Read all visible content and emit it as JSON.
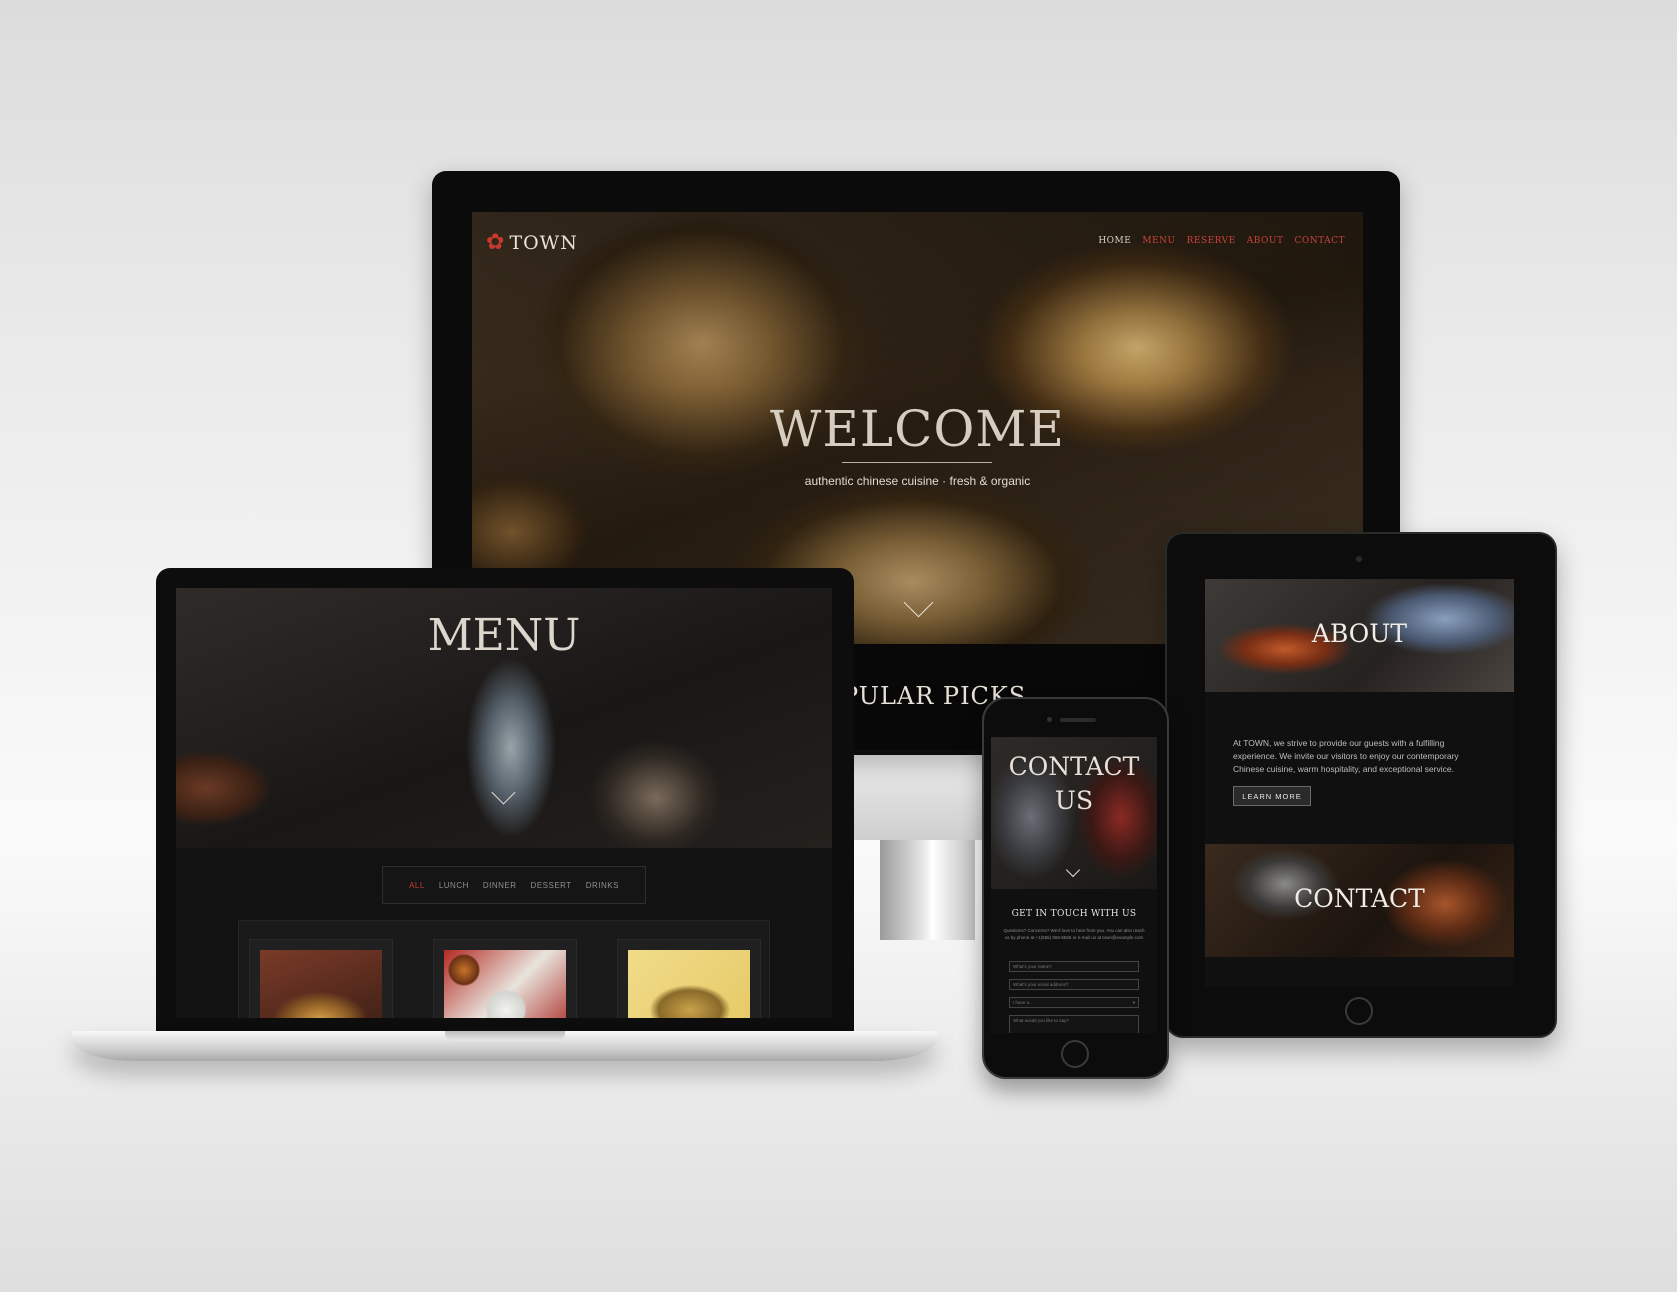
{
  "desktop": {
    "logo_text": "TOWN",
    "logo_mark": "✿",
    "nav": [
      "HOME",
      "MENU",
      "RESERVE",
      "ABOUT",
      "CONTACT"
    ],
    "hero_title": "WELCOME",
    "hero_subtitle": "authentic chinese cuisine · fresh & organic",
    "section_heading": "PULAR PICKS"
  },
  "laptop": {
    "hero_title": "MENU",
    "tabs": [
      "ALL",
      "LUNCH",
      "DINNER",
      "DESSERT",
      "DRINKS"
    ],
    "active_tab": "ALL"
  },
  "tablet": {
    "about_title": "ABOUT",
    "about_text": "At TOWN, we strive to provide our guests with a fulfilling experience. We invite our visitors to enjoy our contemporary Chinese cuisine, warm hospitality, and exceptional service.",
    "learn_more": "LEARN MORE",
    "contact_title": "CONTACT"
  },
  "phone": {
    "hero_title_line1": "CONTACT",
    "hero_title_line2": "US",
    "form_heading": "GET IN TOUCH WITH US",
    "form_copy": "Questions? Concerns? We'd love to hear from you. You can also reach us by phone at +1(555) 555-5555 or e-mail us at town@example.com",
    "name_placeholder": "What's your name?",
    "email_placeholder": "What's your email address?",
    "select_value": "I have a...",
    "message_placeholder": "What would you like to say?"
  },
  "colors": {
    "accent_red": "#c8423a",
    "dark_bg": "#101010"
  }
}
